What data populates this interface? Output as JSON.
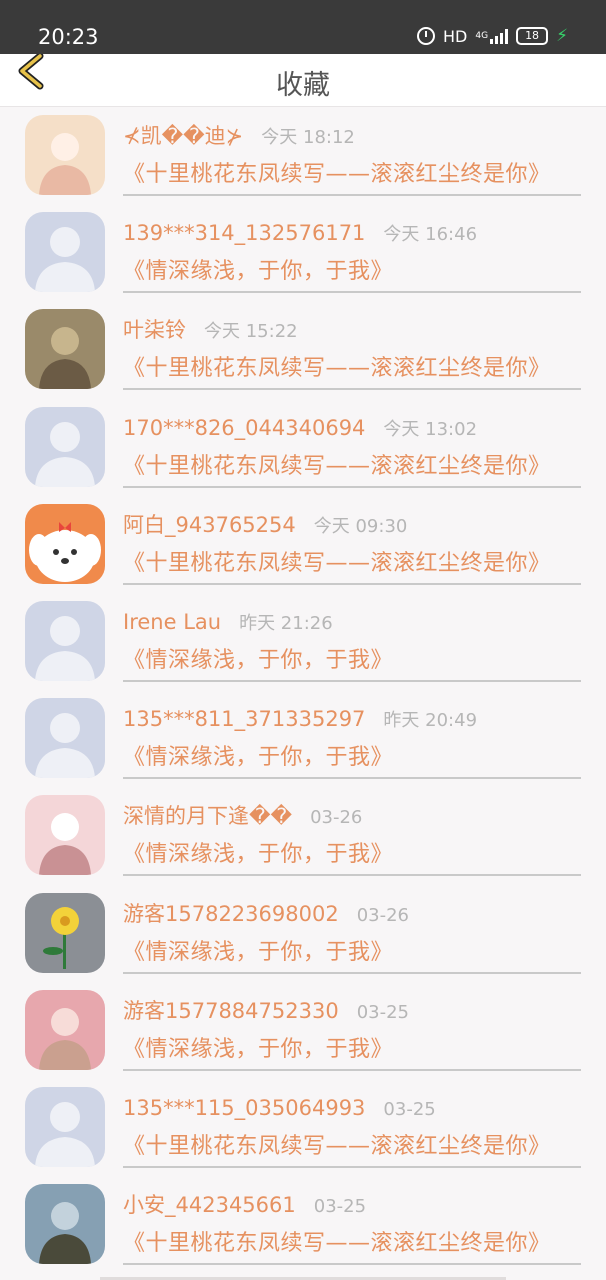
{
  "status": {
    "time": "20:23",
    "network": "HD",
    "net_type": "4G",
    "battery": "18"
  },
  "header": {
    "title": "收藏",
    "back_icon": "chevron-left-icon",
    "accent": "#e7c24a"
  },
  "colors": {
    "name": "#e69160",
    "time": "#b6b6b6",
    "divider": "#c9c9c9"
  },
  "items": [
    {
      "name": "⊀凯��迪⊁",
      "time": "今天 18:12",
      "book": "《十里桃花东凤续写——滚滚红尘终是你》",
      "avatar": "photo"
    },
    {
      "name": "139***314_132576171",
      "time": "今天 16:46",
      "book": "《情深缘浅，于你，于我》",
      "avatar": "default"
    },
    {
      "name": "叶柒铃",
      "time": "今天 15:22",
      "book": "《十里桃花东凤续写——滚滚红尘终是你》",
      "avatar": "photo"
    },
    {
      "name": "170***826_044340694",
      "time": "今天 13:02",
      "book": "《十里桃花东凤续写——滚滚红尘终是你》",
      "avatar": "default"
    },
    {
      "name": "阿白_943765254",
      "time": "今天 09:30",
      "book": "《十里桃花东凤续写——滚滚红尘终是你》",
      "avatar": "dog"
    },
    {
      "name": "Irene Lau",
      "time": "昨天 21:26",
      "book": "《情深缘浅，于你，于我》",
      "avatar": "default"
    },
    {
      "name": "135***811_371335297",
      "time": "昨天 20:49",
      "book": "《情深缘浅，于你，于我》",
      "avatar": "default"
    },
    {
      "name": "深情的月下逢��",
      "time": "03-26",
      "book": "《情深缘浅，于你，于我》",
      "avatar": "photo"
    },
    {
      "name": "游客1578223698002",
      "time": "03-26",
      "book": "《情深缘浅，于你，于我》",
      "avatar": "flower"
    },
    {
      "name": "游客1577884752330",
      "time": "03-25",
      "book": "《情深缘浅，于你，于我》",
      "avatar": "photo"
    },
    {
      "name": "135***115_035064993",
      "time": "03-25",
      "book": "《十里桃花东凤续写——滚滚红尘终是你》",
      "avatar": "default"
    },
    {
      "name": "小安_442345661",
      "time": "03-25",
      "book": "《十里桃花东凤续写——滚滚红尘终是你》",
      "avatar": "photo"
    }
  ]
}
